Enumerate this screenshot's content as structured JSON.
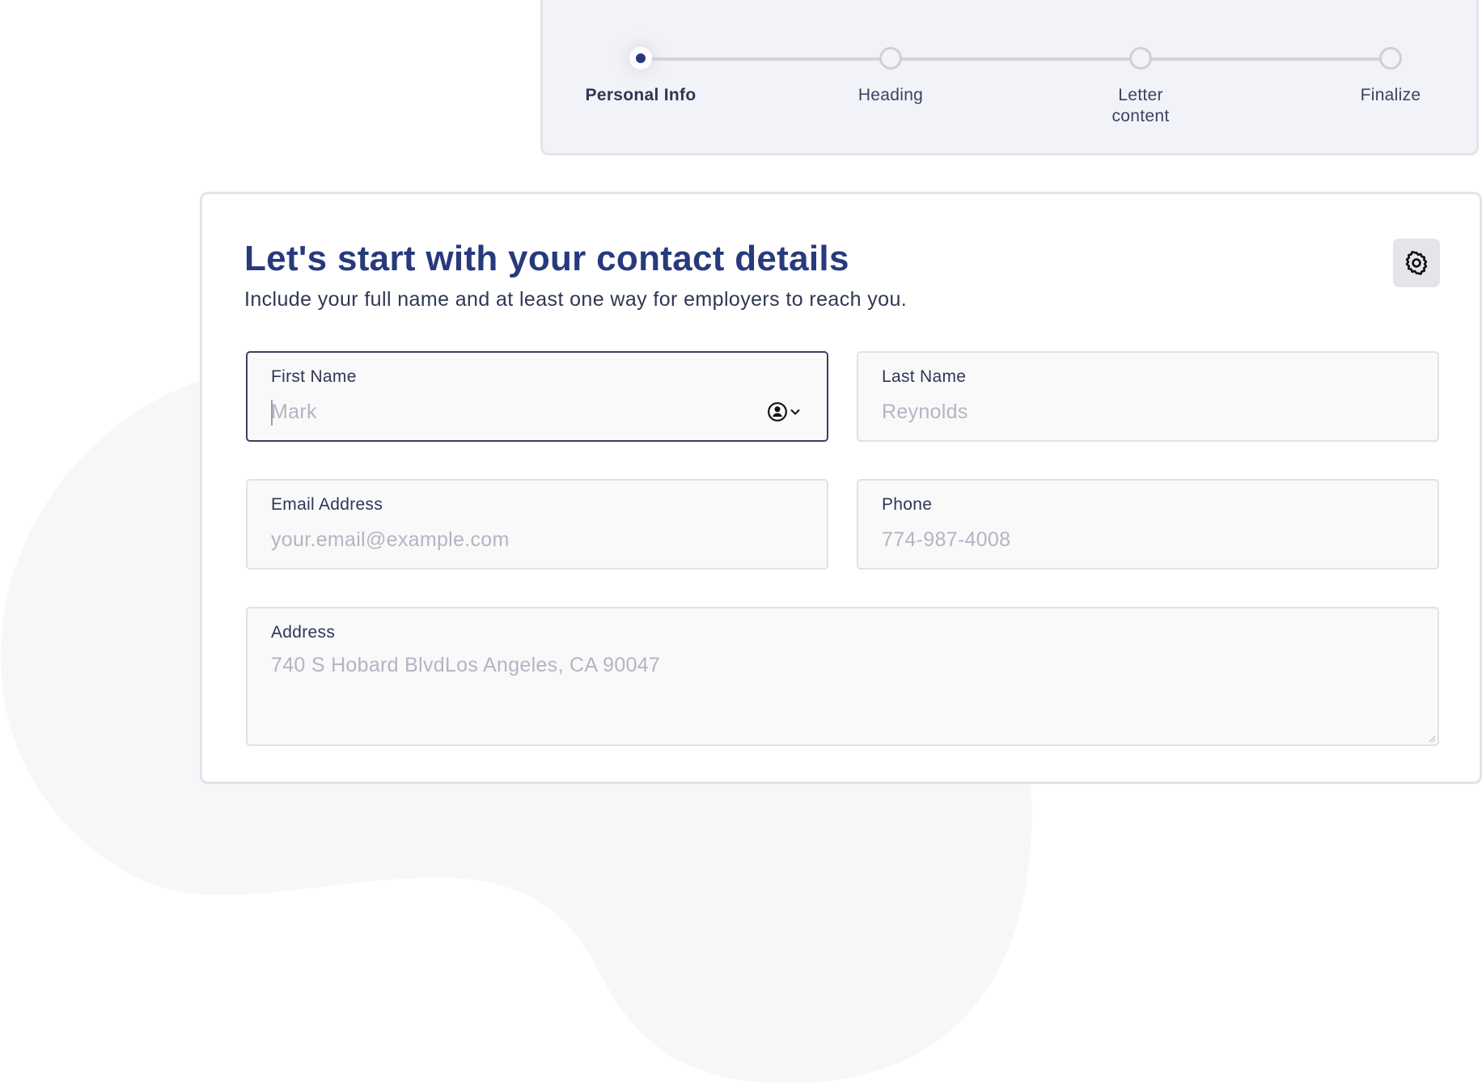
{
  "stepper": {
    "current_step": 1,
    "steps": [
      {
        "label": "Personal Info",
        "state": "active"
      },
      {
        "label": "Heading",
        "state": "upcoming"
      },
      {
        "label": "Letter content",
        "state": "upcoming"
      },
      {
        "label": "Finalize",
        "state": "upcoming"
      }
    ]
  },
  "form": {
    "title": "Let's start with your contact details",
    "subtitle": "Include your full name and at least one way for employers to reach you.",
    "settings_icon": "gear-icon",
    "fields": {
      "first_name": {
        "label": "First Name",
        "value": "",
        "placeholder": "Mark",
        "autofill_icon": "contact-autofill-icon"
      },
      "last_name": {
        "label": "Last Name",
        "value": "",
        "placeholder": "Reynolds"
      },
      "email": {
        "label": "Email Address",
        "value": "",
        "placeholder": "your.email@example.com"
      },
      "phone": {
        "label": "Phone",
        "value": "",
        "placeholder": "774-987-4008"
      },
      "address": {
        "label": "Address",
        "value": "",
        "placeholder": "740 S Hobard BlvdLos Angeles, CA 90047"
      }
    }
  },
  "colors": {
    "brand": "#283a7d",
    "text": "#2f3754",
    "placeholder": "#b3b5c2",
    "panel_bg": "#f2f3f8",
    "field_bg": "#f9f9fa",
    "border": "#e3e4ea"
  }
}
